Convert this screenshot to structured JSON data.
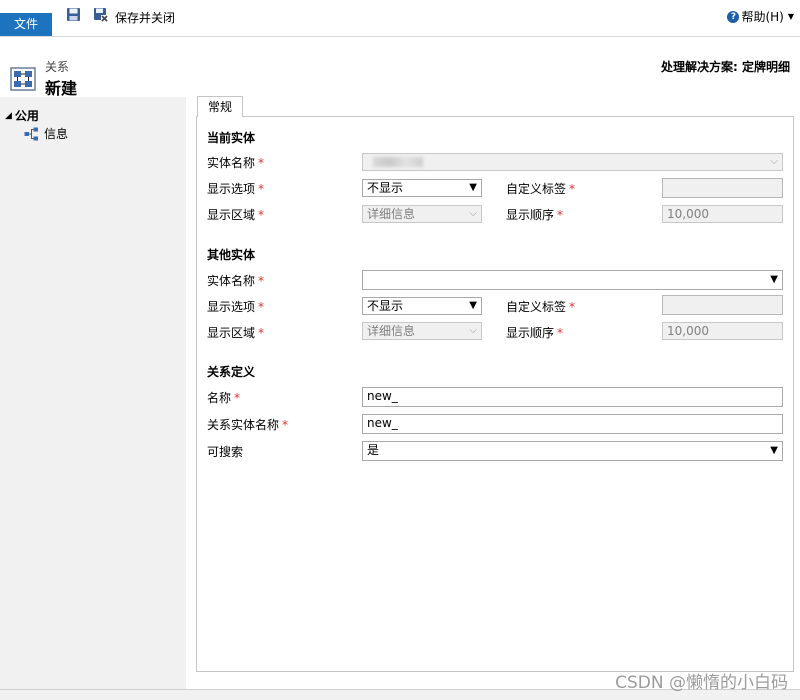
{
  "ribbon": {
    "file_tab": "文件",
    "save_close_label": "保存并关闭",
    "help_label": "帮助(H)",
    "save_icon": "save-icon",
    "save_close_icon": "save-close-icon"
  },
  "header": {
    "breadcrumb": "关系",
    "title": "新建",
    "solution": "处理解决方案: 定牌明细"
  },
  "nav": {
    "group_label": "公用",
    "items": [
      {
        "label": "信息",
        "icon": "relationship-icon"
      }
    ]
  },
  "form": {
    "tab_label": "常规",
    "current_entity": {
      "section_title": "当前实体",
      "entity_name_label": "实体名称",
      "entity_name_value": "",
      "display_option_label": "显示选项",
      "display_option_value": "不显示",
      "custom_label_label": "自定义标签",
      "custom_label_value": "",
      "display_area_label": "显示区域",
      "display_area_value": "详细信息",
      "display_order_label": "显示顺序",
      "display_order_value": "10,000"
    },
    "other_entity": {
      "section_title": "其他实体",
      "entity_name_label": "实体名称",
      "entity_name_value": "",
      "display_option_label": "显示选项",
      "display_option_value": "不显示",
      "custom_label_label": "自定义标签",
      "custom_label_value": "",
      "display_area_label": "显示区域",
      "display_area_value": "详细信息",
      "display_order_label": "显示顺序",
      "display_order_value": "10,000"
    },
    "relationship": {
      "section_title": "关系定义",
      "name_label": "名称",
      "name_value": "new_",
      "rel_entity_label": "关系实体名称",
      "rel_entity_value": "new_",
      "searchable_label": "可搜索",
      "searchable_value": "是"
    },
    "required_marker": "*"
  },
  "watermark": "CSDN @懒惰的小白码",
  "colors": {
    "accent": "#1e73be",
    "required": "#e0322e",
    "nav_bg": "#f1f1f1"
  }
}
